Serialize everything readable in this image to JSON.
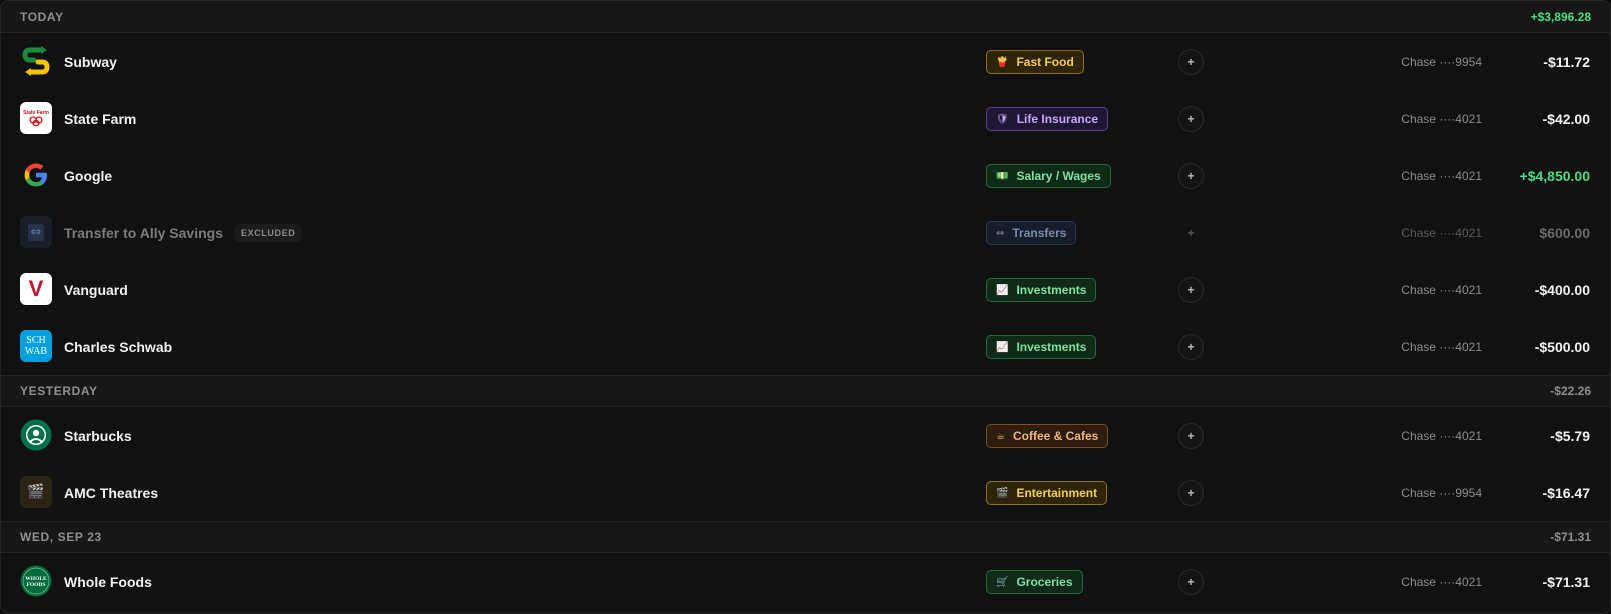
{
  "groups": [
    {
      "label": "TODAY",
      "total": "+$3,896.28",
      "rows": [
        {
          "merchant": "Subway",
          "category_icon": "🍟",
          "category": "Fast Food",
          "account": "Chase ····9954",
          "amount": "-$11.72",
          "add": "+"
        },
        {
          "merchant": "State Farm",
          "category_icon": "🛡",
          "category": "Life Insurance",
          "account": "Chase ····4021",
          "amount": "-$42.00",
          "add": "+"
        },
        {
          "merchant": "Google",
          "category_icon": "💵",
          "category": "Salary / Wages",
          "account": "Chase ····4021",
          "amount": "+$4,850.00",
          "add": "+"
        },
        {
          "merchant": "Transfer to Ally Savings",
          "badge": "EXCLUDED",
          "category_icon": "⇔",
          "category": "Transfers",
          "account": "Chase ····4021",
          "amount": "$600.00",
          "add": "+"
        },
        {
          "merchant": "Vanguard",
          "category_icon": "📈",
          "category": "Investments",
          "account": "Chase ····4021",
          "amount": "-$400.00",
          "add": "+"
        },
        {
          "merchant": "Charles Schwab",
          "category_icon": "📈",
          "category": "Investments",
          "account": "Chase ····4021",
          "amount": "-$500.00",
          "add": "+"
        }
      ]
    },
    {
      "label": "YESTERDAY",
      "total": "-$22.26",
      "rows": [
        {
          "merchant": "Starbucks",
          "category_icon": "☕",
          "category": "Coffee & Cafes",
          "account": "Chase ····4021",
          "amount": "-$5.79",
          "add": "+"
        },
        {
          "merchant": "AMC Theatres",
          "category_icon": "🎬",
          "category": "Entertainment",
          "account": "Chase ····9954",
          "amount": "-$16.47",
          "add": "+"
        }
      ]
    },
    {
      "label": "WED, SEP 23",
      "total": "-$71.31",
      "rows": [
        {
          "merchant": "Whole Foods",
          "category_icon": "🛒",
          "category": "Groceries",
          "account": "Chase ····4021",
          "amount": "-$71.31",
          "add": "+"
        }
      ]
    }
  ],
  "logos": {
    "subway": "S",
    "state_farm": "State Farm",
    "google": "G",
    "transfer": "⇔",
    "vanguard": "V",
    "schwab_top": "SCH",
    "schwab_bottom": "WAB",
    "starbucks": "★",
    "amc": "🎬",
    "whole_foods_top": "WHOLE",
    "whole_foods_bottom": "FOODS"
  },
  "colors": {
    "positive": "#4ade80",
    "background": "#111111",
    "header_background": "#171717"
  }
}
